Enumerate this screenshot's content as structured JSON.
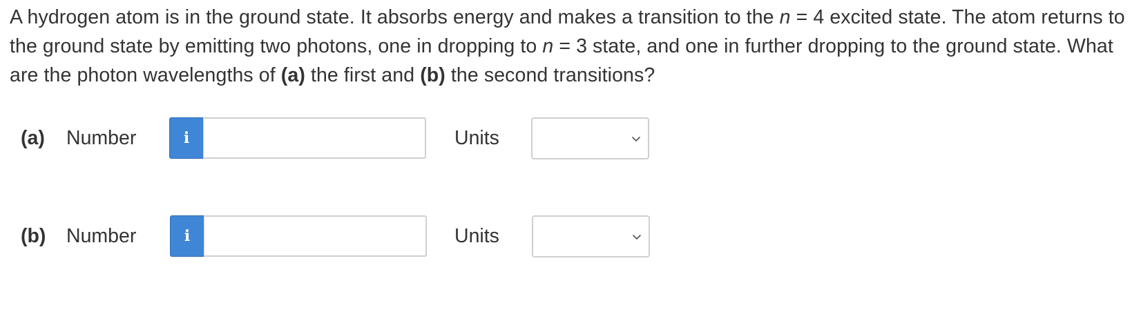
{
  "question": {
    "part1": "A hydrogen atom is in the ground state. It absorbs energy and makes a transition to the ",
    "n_var_1": "n",
    "part2": " = 4 excited state. The atom returns to the ground state by emitting two photons, one in dropping to ",
    "n_var_2": "n",
    "part3": " = 3 state, and one in further dropping to the ground state. What are the photon wavelengths of ",
    "bold_a": "(a)",
    "part4": " the first and ",
    "bold_b": "(b)",
    "part5": " the second transitions?"
  },
  "answers": [
    {
      "part_label": "(a)",
      "number_label": "Number",
      "info_icon": "i",
      "number_value": "",
      "units_label": "Units",
      "units_value": ""
    },
    {
      "part_label": "(b)",
      "number_label": "Number",
      "info_icon": "i",
      "number_value": "",
      "units_label": "Units",
      "units_value": ""
    }
  ],
  "colors": {
    "info_button": "#3f86d6",
    "text": "#333333",
    "input_border": "#cfcfcf"
  }
}
